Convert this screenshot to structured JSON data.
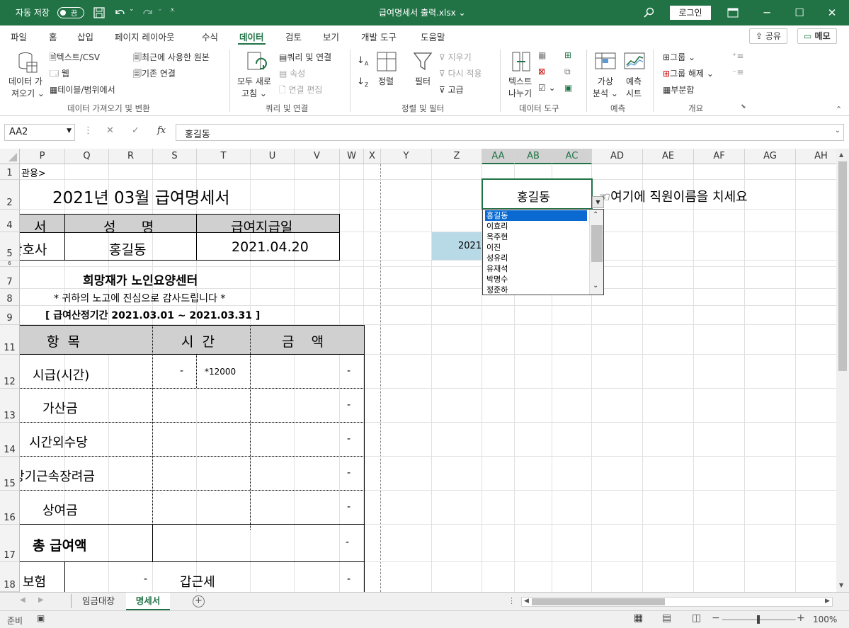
{
  "titlebar": {
    "autosave_label": "자동 저장",
    "autosave_state": "끔",
    "filename": "급여명세서 출력.xlsx",
    "filename_caret": "⌄",
    "login_label": "로그인"
  },
  "menu": {
    "tabs": [
      "파일",
      "홈",
      "삽입",
      "페이지 레이아웃",
      "수식",
      "데이터",
      "검토",
      "보기",
      "개발 도구",
      "도움말"
    ],
    "active_tab": "데이터",
    "share_label": "공유",
    "memo_label": "메모"
  },
  "ribbon": {
    "get_data": {
      "big_button": [
        "데이터 가",
        "져오기 ⌄"
      ],
      "items": [
        "텍스트/CSV",
        "웹",
        "테이블/범위에서",
        "최근에 사용한 원본",
        "기존 연결"
      ],
      "group_label": "데이터 가져오기 및 변환"
    },
    "queries": {
      "big_button": [
        "모두 새로",
        "고침 ⌄"
      ],
      "items": [
        "쿼리 및 연결",
        "속성",
        "연결 편집"
      ],
      "group_label": "쿼리 및 연결"
    },
    "sort_filter": {
      "sort_label": "정렬",
      "filter_label": "필터",
      "items": [
        "지우기",
        "다시 적용",
        "고급"
      ],
      "group_label": "정렬 및 필터"
    },
    "data_tools": {
      "big_button": [
        "텍스트",
        "나누기"
      ],
      "group_label": "데이터 도구"
    },
    "forecast": {
      "whatif": [
        "가상",
        "분석 ⌄"
      ],
      "sheet": [
        "예측",
        "시트"
      ],
      "group_label": "예측"
    },
    "outline": {
      "items": [
        "그룹  ⌄",
        "그룹 해제  ⌄",
        "부분합"
      ],
      "group_label": "개요"
    }
  },
  "formula_bar": {
    "name_box": "AA2",
    "fx": "fx",
    "value": "홍길동"
  },
  "columns": [
    "P",
    "Q",
    "R",
    "S",
    "T",
    "U",
    "V",
    "W",
    "X",
    "Y",
    "Z",
    "AA",
    "AB",
    "AC",
    "AD",
    "AE",
    "AF",
    "AG",
    "AH"
  ],
  "selected_columns": [
    "AA",
    "AB",
    "AC"
  ],
  "rows": [
    "1",
    "2",
    "4",
    "5",
    "6",
    "7",
    "8",
    "9",
    "11",
    "12",
    "13",
    "14",
    "15",
    "16",
    "17",
    "18"
  ],
  "sheet": {
    "r1_text": "관용>",
    "title": "2021년 03월 급여명세서",
    "h_dept": "서",
    "h_name": "성      명",
    "h_paydate": "급여지급일",
    "dept": "간호사",
    "name": "홍길동",
    "paydate": "2021.04.20",
    "z5_value": "2021",
    "company": "희망재가 노인요양센터",
    "greeting": "* 귀하의 노고에 진심으로 감사드립니다 *",
    "period": "[ 급여산정기간 2021.03.01 ~ 2021.03.31 ]",
    "table_headers": [
      "항  목",
      "시  간",
      "금    액"
    ],
    "items": [
      {
        "label": "시급(시간)",
        "time": "-",
        "rate": "*12000",
        "amount": "-"
      },
      {
        "label": "가산금",
        "amount": "-"
      },
      {
        "label": "시간외수당",
        "amount": "-"
      },
      {
        "label": "장기근속장려금",
        "amount": "-"
      },
      {
        "label": "상여금",
        "amount": "-"
      }
    ],
    "total_label": "총 급여액",
    "total_amount": "-",
    "r18_label": "보험",
    "r18_value": "-",
    "r18_tax_label": "갑근세",
    "r18_tax_value": "-",
    "aa2_value": "홍길동",
    "hint": "☜여기에 직원이름을 치세요"
  },
  "dropdown": {
    "options": [
      "홍길동",
      "이효리",
      "옥주현",
      "이진",
      "성유리",
      "유재석",
      "박명수",
      "정준하"
    ],
    "selected": "홍길동"
  },
  "sheet_tabs": [
    "임금대장",
    "명세서"
  ],
  "active_sheet": "명세서",
  "status": {
    "ready": "준비",
    "zoom": "100%"
  },
  "colors": {
    "brand": "#217346",
    "header_fill": "#d0d0d0",
    "z5_fill": "#b8d9e6",
    "selection_blue": "#0a6ad2"
  }
}
